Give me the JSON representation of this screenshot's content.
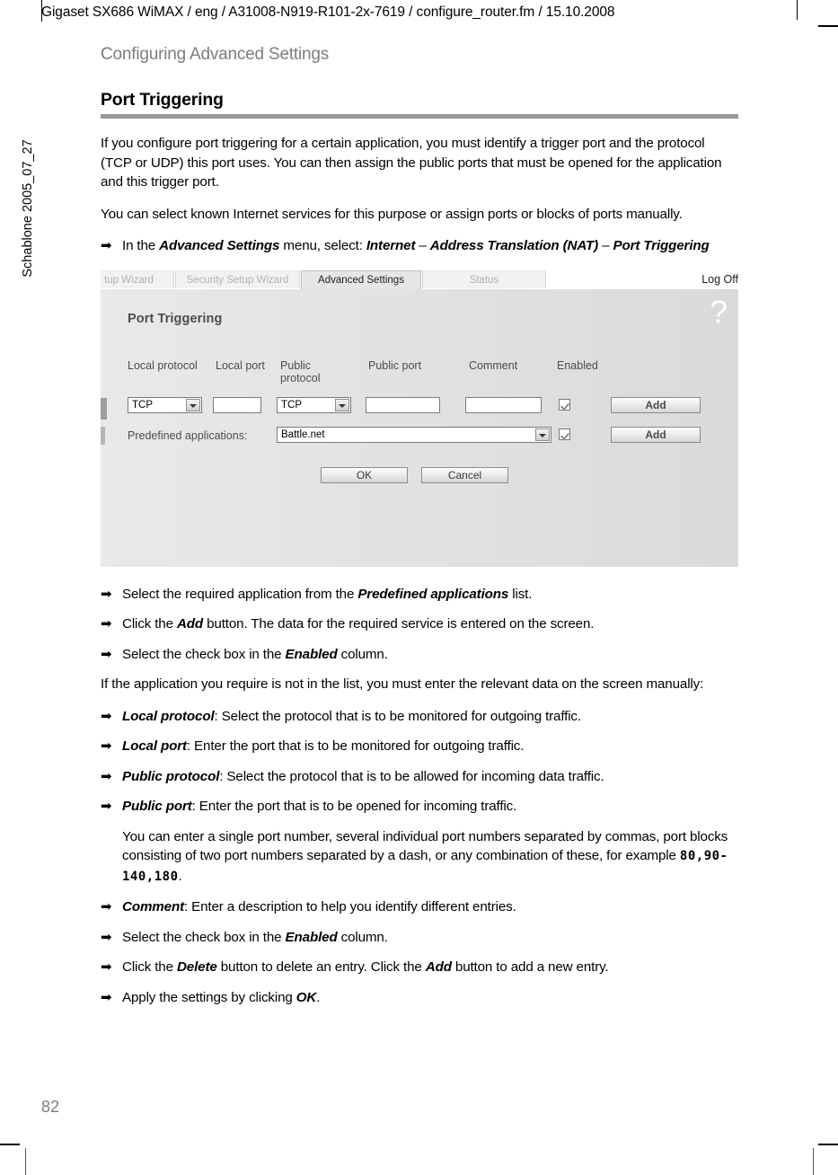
{
  "document": {
    "running_header": "Gigaset SX686 WiMAX / eng / A31008-N919-R101-2x-7619 / configure_router.fm / 15.10.2008",
    "side_label": "Schablone 2005_07_27",
    "page_number": "82",
    "chapter_title": "Configuring Advanced Settings",
    "section_title": "Port Triggering"
  },
  "intro": {
    "paragraph_1": "If you configure port triggering for a certain application, you must identify a trigger port and the protocol (TCP or UDP) this port uses. You can then assign the public ports that must be opened for the application and this trigger port.",
    "paragraph_2": "You can select known Internet services for this purpose or assign ports or blocks of ports manually.",
    "step_menu": {
      "prefix": "In the ",
      "bold_1": "Advanced Settings",
      "middle": " menu, select: ",
      "bold_2": "Internet",
      "dash_1": " – ",
      "bold_3": "Address Translation (NAT)",
      "dash_2": " – ",
      "bold_4": "Port Triggering"
    }
  },
  "router_screenshot": {
    "tabs": [
      {
        "label": "tup Wizard",
        "active": false
      },
      {
        "label": "Security Setup Wizard",
        "active": false
      },
      {
        "label": "Advanced Settings",
        "active": true
      },
      {
        "label": "Status",
        "active": false
      }
    ],
    "logoff_label": "Log Off",
    "panel_title": "Port Triggering",
    "help_icon": "question-mark-icon",
    "column_headers": {
      "local_protocol": "Local protocol",
      "local_port": "Local port",
      "public_protocol": "Public protocol",
      "public_port": "Public port",
      "comment": "Comment",
      "enabled": "Enabled"
    },
    "row": {
      "local_protocol_value": "TCP",
      "local_port_value": "",
      "public_protocol_value": "TCP",
      "public_port_value": "",
      "comment_value": "",
      "enabled_checked": true,
      "add_label": "Add"
    },
    "predefined": {
      "label": "Predefined applications:",
      "value": "Battle.net",
      "enabled_checked": true,
      "add_label": "Add"
    },
    "footer_buttons": {
      "ok_label": "OK",
      "cancel_label": "Cancel"
    },
    "colors": {
      "panel_bg": "#e3e3e3",
      "active_tab_bg": "#e6e6e6",
      "inactive_tab_bg": "#f2f2f2",
      "label_text": "#4c4c4c"
    }
  },
  "steps_after": {
    "s1": {
      "pre": "Select the required application from the ",
      "bold": "Predefined applications",
      "post": " list."
    },
    "s2": {
      "pre": "Click the ",
      "bold": "Add",
      "post": " button. The data for the required service is entered on the screen."
    },
    "s3": {
      "pre": "Select the check box in the ",
      "bold": "Enabled",
      "post": " column."
    }
  },
  "manual_intro": "If the application you require is not in the list, you must enter the relevant data on the screen manually:",
  "field_steps": [
    {
      "bold": "Local protocol",
      "post": ": Select the protocol that is to be monitored for outgoing traffic."
    },
    {
      "bold": "Local port",
      "post": ": Enter the port that is to be monitored for outgoing traffic."
    },
    {
      "bold": "Public protocol",
      "post": ": Select the protocol that is to be allowed for incoming data traffic."
    },
    {
      "bold": "Public port",
      "post": ": Enter the port that is to be opened for incoming traffic."
    }
  ],
  "port_note": {
    "pre": "You can enter a single port number, several individual port numbers separated by commas, port blocks consisting of two port numbers separated by a dash, or any combination of these, for example ",
    "example": "80,90-140,180",
    "post": "."
  },
  "final_steps": {
    "f1": {
      "pre": "",
      "bold": "Comment",
      "post": ": Enter a description to help you identify different entries."
    },
    "f2": {
      "pre": "Select the check box in the ",
      "bold": "Enabled",
      "post": " column."
    },
    "f3": {
      "pre": "Click the ",
      "bold": "Delete",
      "mid": " button to delete an entry. Click the ",
      "bold2": "Add",
      "post": " button to add a new entry."
    },
    "f4": {
      "pre": "Apply the settings by clicking ",
      "bold": "OK",
      "post": "."
    }
  }
}
